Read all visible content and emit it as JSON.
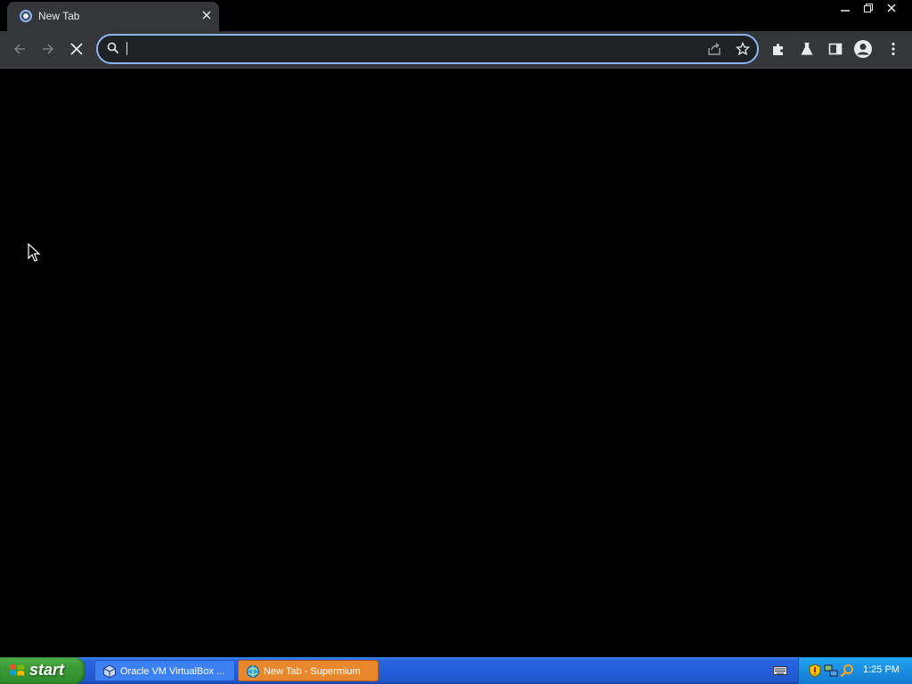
{
  "browser": {
    "tab": {
      "title": "New Tab",
      "favicon": "browser-logo-icon",
      "close_icon": "close-icon"
    },
    "window_controls": [
      "minimize-icon",
      "restore-icon",
      "close-icon"
    ],
    "toolbar": {
      "back_icon": "arrow-left-icon",
      "forward_icon": "arrow-right-icon",
      "stop_icon": "stop-loading-icon",
      "omnibox": {
        "value": "",
        "placeholder": "",
        "search_icon": "search-icon"
      },
      "share_icon": "share-icon",
      "bookmark_icon": "star-icon",
      "extensions_icon": "puzzle-icon",
      "labs_icon": "flask-icon",
      "side_panel_icon": "side-panel-icon",
      "profile_icon": "avatar-icon",
      "menu_icon": "kebab-menu-icon"
    },
    "colors": {
      "accent": "#8ab4f8",
      "chrome": "#35363a",
      "page": "#000000"
    }
  },
  "taskbar": {
    "start_label": "start",
    "items": [
      {
        "label": "Oracle VM VirtualBox ...",
        "icon": "virtualbox-icon",
        "active": false
      },
      {
        "label": "New Tab - Supermium",
        "icon": "browser-icon",
        "active": true
      }
    ],
    "tray": {
      "icons": [
        "security-shield-icon",
        "network-icon",
        "search-icon"
      ],
      "clock": "1:25 PM"
    },
    "colors": {
      "bar": "#245edb",
      "start": "#3c9b36",
      "active_item": "#e9872d",
      "tray": "#1a8ee0"
    }
  }
}
